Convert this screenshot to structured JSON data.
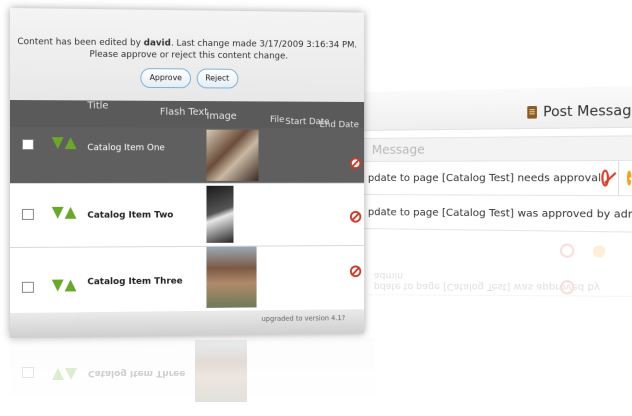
{
  "notice": {
    "prefix": "Content has been edited by ",
    "user": "david",
    "suffix": ". Last change made 3/17/2009 3:16:34 PM.",
    "line2": "Please approve or reject this content change.",
    "approve": "Approve",
    "reject": "Reject"
  },
  "columns": {
    "title": "Title",
    "flash_text": "Flash Text",
    "image": "Image",
    "file": "File",
    "start_date": "Start Date",
    "end_date": "End Date"
  },
  "items": [
    {
      "title": "Catalog Item One"
    },
    {
      "title": "Catalog Item Two"
    },
    {
      "title": "Catalog Item Three"
    }
  ],
  "footer_text": "upgraded to version 4.1?",
  "back": {
    "post_message": "Post Message",
    "message_header": "Message",
    "rows": [
      {
        "text": "pdate to page [Catalog Test] needs approval"
      },
      {
        "text": "pdate to page [Catalog Test] was approved by admin"
      }
    ]
  }
}
